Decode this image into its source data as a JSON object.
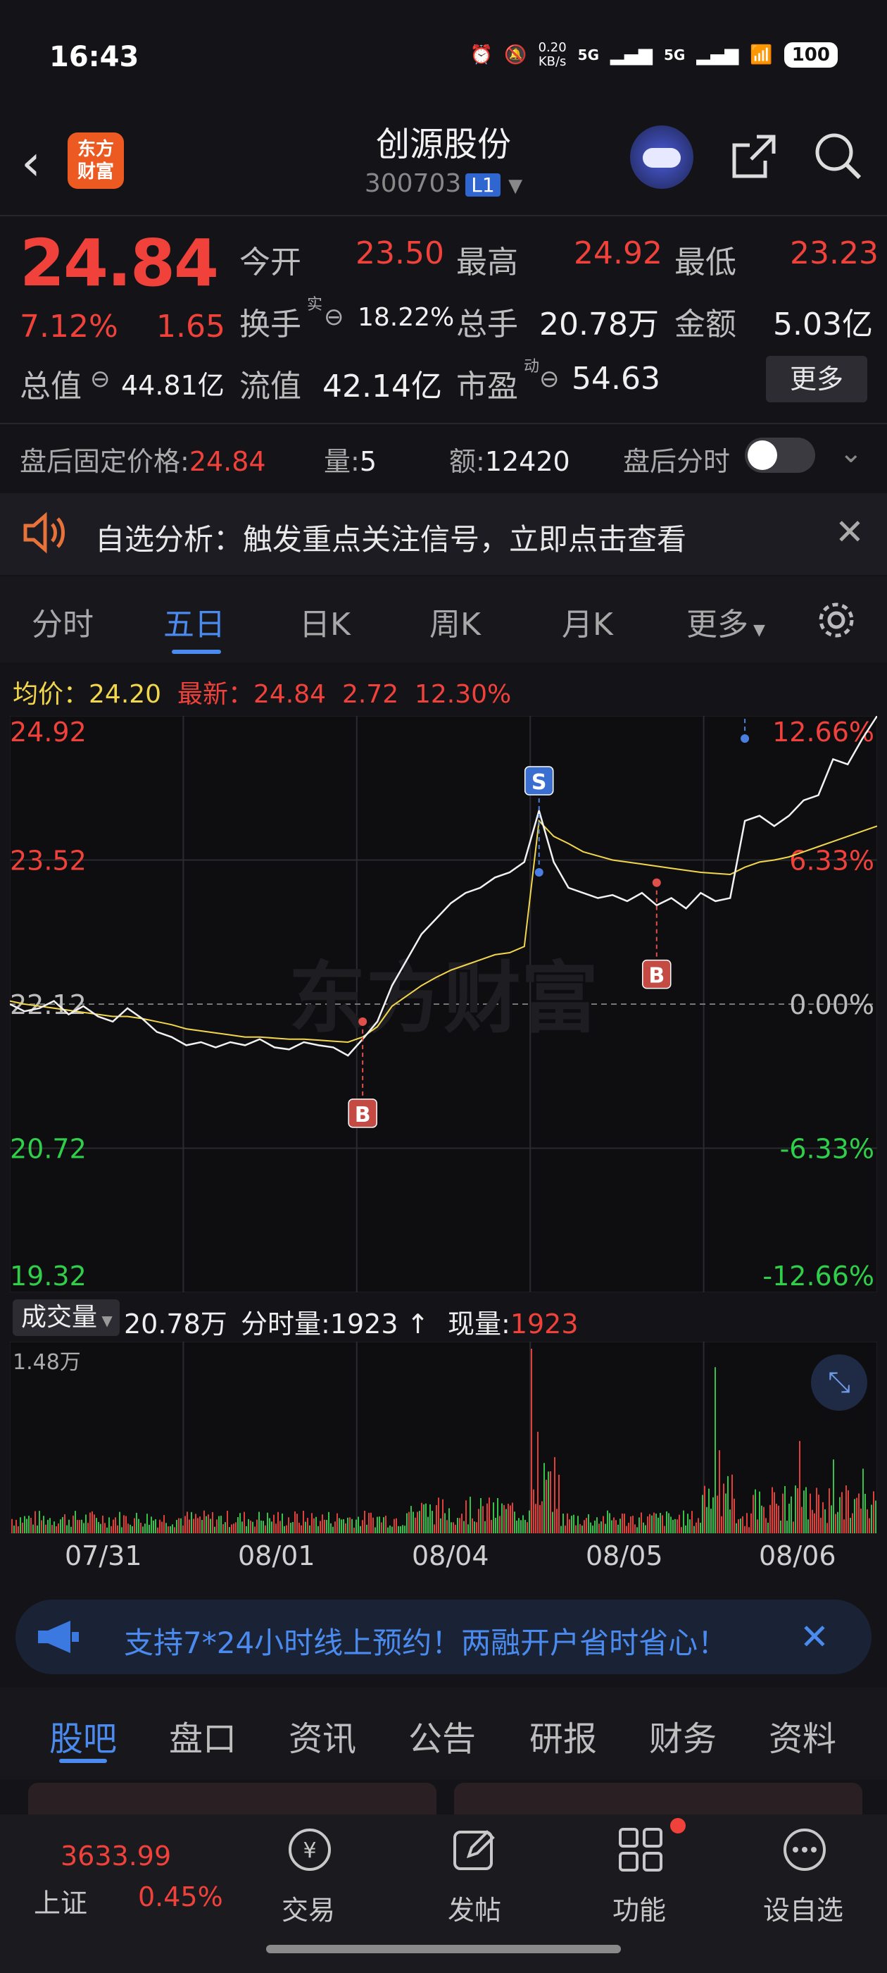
{
  "status_bar": {
    "time": "16:43",
    "net_speed": "0.20\nKB/s",
    "signal1": "5G",
    "signal2": "5G",
    "battery": "100"
  },
  "header": {
    "back_icon": "back-arrow-icon",
    "logo_text_1": "东方",
    "logo_text_2": "财富",
    "stock_name": "创源股份",
    "stock_code": "300703",
    "level_badge": "L1"
  },
  "quote": {
    "price": "24.84",
    "change_pct": "7.12%",
    "change": "1.65",
    "open_label": "今开",
    "open": "23.50",
    "high_label": "最高",
    "high": "24.92",
    "low_label": "最低",
    "low": "23.23",
    "turnover_label": "换手",
    "turnover_sup": "实",
    "turnover": "18.22%",
    "volume_label": "总手",
    "volume": "20.78万",
    "amount_label": "金额",
    "amount": "5.03亿",
    "mktcap_label": "总值",
    "mktcap": "44.81亿",
    "float_label": "流值",
    "float": "42.14亿",
    "pe_label": "市盈",
    "pe_sup": "动",
    "pe": "54.63",
    "more_button": "更多"
  },
  "after_hours": {
    "fixed_price_label": "盘后固定价格:",
    "fixed_price": "24.84",
    "vol_label": "量:",
    "vol": "5",
    "amt_label": "额:",
    "amt": "12420",
    "timeshare_label": "盘后分时"
  },
  "notice": {
    "text": "自选分析：触发重点关注信号，立即点击查看"
  },
  "chart_tabs": [
    {
      "label": "分时"
    },
    {
      "label": "五日"
    },
    {
      "label": "日K"
    },
    {
      "label": "周K"
    },
    {
      "label": "月K"
    },
    {
      "label": "更多"
    }
  ],
  "chart_info": {
    "avg_label": "均价：",
    "avg": "24.20",
    "latest_label": "最新：",
    "latest": "24.84",
    "latest_change": "2.72",
    "latest_pct": "12.30%"
  },
  "chart_data": {
    "type": "line",
    "x_days": [
      "07/31",
      "08/01",
      "08/04",
      "08/05",
      "08/06"
    ],
    "y_ticks_left": [
      "24.92",
      "23.52",
      "22.12",
      "20.72",
      "19.32"
    ],
    "y_ticks_right": [
      "12.66%",
      "6.33%",
      "0.00%",
      "-6.33%",
      "-12.66%"
    ],
    "ylim": [
      19.32,
      24.92
    ],
    "prev_close": 22.12,
    "series": [
      {
        "values": [
          22.12,
          22.05,
          22.08,
          22.15,
          22.02,
          22.1,
          22.0,
          21.95,
          22.08,
          21.98,
          21.85,
          21.8,
          21.72,
          21.75,
          21.7,
          21.75,
          21.72,
          21.78,
          21.7,
          21.68,
          21.75,
          21.72,
          21.7,
          21.62,
          21.78,
          21.95,
          22.3,
          22.55,
          22.8,
          22.95,
          23.1,
          23.2,
          23.25,
          23.35,
          23.4,
          23.5,
          24.0,
          23.5,
          23.25,
          23.2,
          23.15,
          23.18,
          23.12,
          23.2,
          23.08,
          23.15,
          23.05,
          23.2,
          23.12,
          23.15,
          23.9,
          23.95,
          23.85,
          23.95,
          24.1,
          24.15,
          24.5,
          24.45,
          24.7,
          24.92
        ]
      },
      {
        "values": [
          22.15,
          22.12,
          22.1,
          22.08,
          22.06,
          22.04,
          22.02,
          22.0,
          22.0,
          21.98,
          21.95,
          21.92,
          21.88,
          21.86,
          21.84,
          21.82,
          21.8,
          21.8,
          21.79,
          21.78,
          21.78,
          21.77,
          21.76,
          21.75,
          21.8,
          21.9,
          22.1,
          22.2,
          22.3,
          22.38,
          22.45,
          22.5,
          22.55,
          22.6,
          22.62,
          22.68,
          23.9,
          23.75,
          23.68,
          23.6,
          23.56,
          23.52,
          23.5,
          23.48,
          23.46,
          23.44,
          23.42,
          23.4,
          23.39,
          23.38,
          23.45,
          23.5,
          23.52,
          23.55,
          23.6,
          23.65,
          23.7,
          23.75,
          23.8,
          23.85
        ]
      }
    ],
    "markers": [
      {
        "label": "B",
        "x_index": 24,
        "y": 21.95
      },
      {
        "label": "S",
        "x_index": 36,
        "y": 23.4
      },
      {
        "label": "B",
        "x_index": 44,
        "y": 23.3
      },
      {
        "label": "S",
        "x_index": 50,
        "y": 24.7
      }
    ]
  },
  "volume": {
    "selector": "成交量",
    "total": "20.78万",
    "tick_label": "分时量:",
    "tick": "1923",
    "current_label": "现量:",
    "current": "1923",
    "ymax": "1.48万"
  },
  "promo": {
    "text": "支持7*24小时线上预约！两融开户省时省心！"
  },
  "bottom_tabs": [
    {
      "label": "股吧"
    },
    {
      "label": "盘口"
    },
    {
      "label": "资讯"
    },
    {
      "label": "公告"
    },
    {
      "label": "研报"
    },
    {
      "label": "财务"
    },
    {
      "label": "资料"
    }
  ],
  "bottom_bar": {
    "index_value": "3633.99",
    "index_name": "上证",
    "index_pct": "0.45%",
    "trade": "交易",
    "post": "发帖",
    "function": "功能",
    "watchlist": "设自选"
  },
  "colors": {
    "up": "#f0413b",
    "down": "#2fcf4a",
    "accent": "#4b8bf0",
    "avg_line": "#f2d64b"
  }
}
